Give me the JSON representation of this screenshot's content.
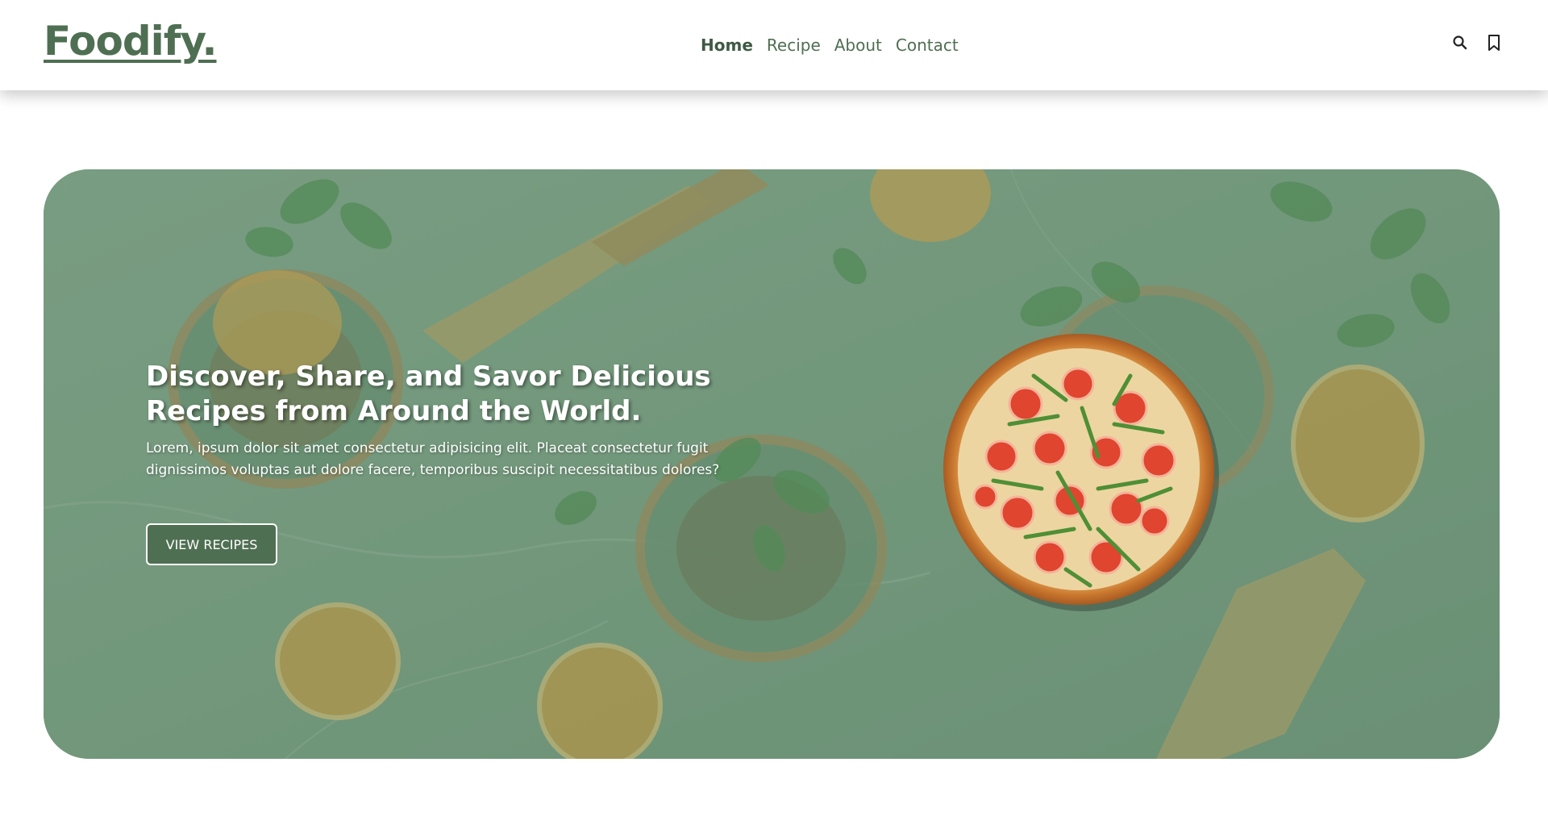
{
  "header": {
    "logo": "Foodify.",
    "nav": [
      {
        "label": "Home",
        "active": true
      },
      {
        "label": "Recipe",
        "active": false
      },
      {
        "label": "About",
        "active": false
      },
      {
        "label": "Contact",
        "active": false
      }
    ],
    "icons": [
      "search-icon",
      "bookmark-icon"
    ]
  },
  "hero": {
    "title": "Discover, Share, and Savor Delicious Recipes from Around the World.",
    "text": "Lorem, ipsum dolor sit amet consectetur adipisicing elit. Placeat consectetur fugit dignissimos voluptas aut dolore facere, temporibus suscipit necessitatibus dolores?",
    "button_label": "VIEW RECIPES"
  },
  "colors": {
    "brand": "#4f6f52",
    "hero_tint": "#7a9d83",
    "white": "#ffffff"
  }
}
